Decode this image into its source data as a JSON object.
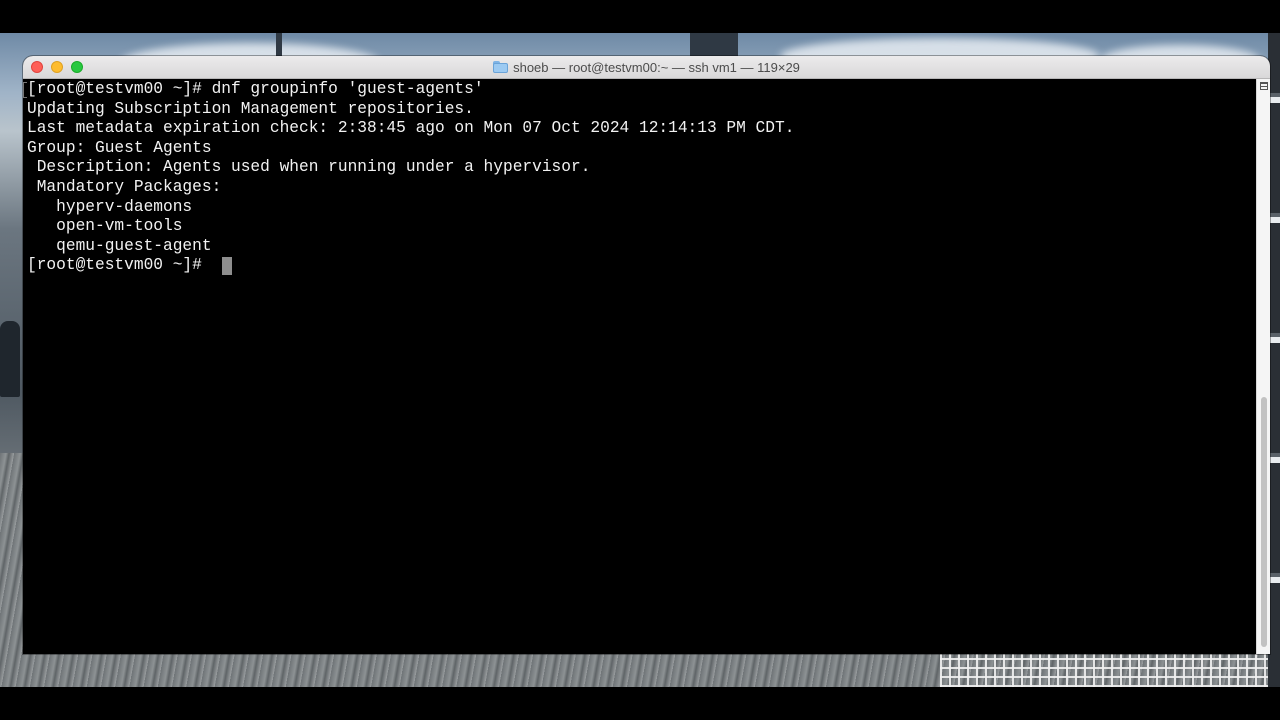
{
  "window": {
    "title": "shoeb — root@testvm00:~ — ssh vm1 — 119×29"
  },
  "terminal": {
    "lines": [
      "[root@testvm00 ~]# dnf groupinfo 'guest-agents'",
      "Updating Subscription Management repositories.",
      "Last metadata expiration check: 2:38:45 ago on Mon 07 Oct 2024 12:14:13 PM CDT.",
      "Group: Guest Agents",
      " Description: Agents used when running under a hypervisor.",
      " Mandatory Packages:",
      "   hyperv-daemons",
      "   open-vm-tools",
      "   qemu-guest-agent"
    ],
    "prompt": "[root@testvm00 ~]# "
  },
  "icons": {
    "title_icon": "folder-icon",
    "split_icon": "split-view-icon"
  },
  "colors": {
    "terminal_bg": "#000000",
    "terminal_fg": "#f2f2f2",
    "cursor": "#8e8e8e",
    "close": "#fe5f57",
    "minimize": "#febc2e",
    "zoom": "#28c840"
  }
}
